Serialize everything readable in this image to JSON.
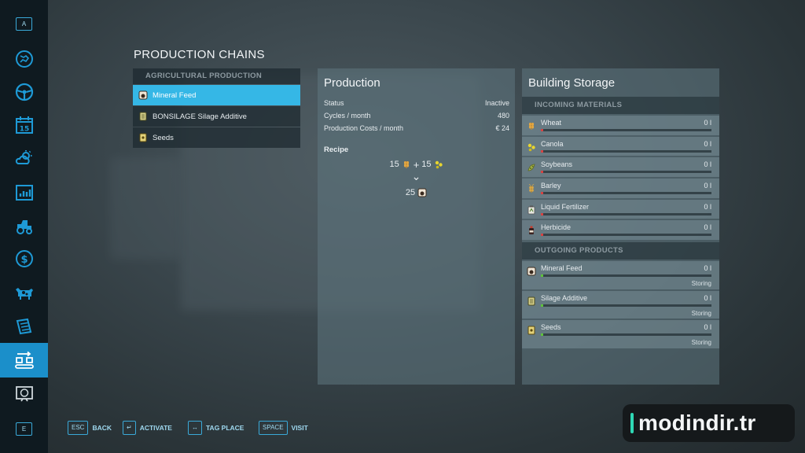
{
  "sidebar": {
    "top_key": "A",
    "bottom_key": "E",
    "items": [
      {
        "icon": "map-icon"
      },
      {
        "icon": "steering-wheel-icon"
      },
      {
        "icon": "calendar-icon",
        "label": "15"
      },
      {
        "icon": "weather-icon"
      },
      {
        "icon": "statistics-icon"
      },
      {
        "icon": "tractor-icon"
      },
      {
        "icon": "finances-icon"
      },
      {
        "icon": "animals-icon"
      },
      {
        "icon": "contracts-icon"
      },
      {
        "icon": "production-icon",
        "active": true
      },
      {
        "icon": "help-icon"
      }
    ]
  },
  "page_title": "PRODUCTION CHAINS",
  "chains": {
    "header": "AGRICULTURAL PRODUCTION",
    "items": [
      {
        "label": "Mineral Feed",
        "icon": "mineral-feed-icon",
        "selected": true
      },
      {
        "label": "BONSILAGE Silage Additive",
        "icon": "silage-additive-icon"
      },
      {
        "label": "Seeds",
        "icon": "seeds-icon"
      }
    ]
  },
  "production": {
    "title": "Production",
    "status_label": "Status",
    "status_value": "Inactive",
    "cycles_label": "Cycles / month",
    "cycles_value": "480",
    "costs_label": "Production Costs / month",
    "costs_value": "€ 24",
    "recipe_label": "Recipe",
    "recipe_inputs": [
      {
        "amount": "15",
        "icon": "wheat-icon"
      },
      {
        "amount": "15",
        "icon": "canola-icon"
      }
    ],
    "recipe_plus": "+",
    "recipe_arrow": "⌄",
    "recipe_output": {
      "amount": "25",
      "icon": "mineral-feed-icon"
    }
  },
  "storage": {
    "title": "Building Storage",
    "incoming_header": "INCOMING MATERIALS",
    "incoming": [
      {
        "name": "Wheat",
        "value": "0 l",
        "icon": "wheat-icon",
        "fill": 0
      },
      {
        "name": "Canola",
        "value": "0 l",
        "icon": "canola-icon",
        "fill": 0
      },
      {
        "name": "Soybeans",
        "value": "0 l",
        "icon": "soybeans-icon",
        "fill": 0
      },
      {
        "name": "Barley",
        "value": "0 l",
        "icon": "barley-icon",
        "fill": 0
      },
      {
        "name": "Liquid Fertilizer",
        "value": "0 l",
        "icon": "liquid-fertilizer-icon",
        "fill": 0
      },
      {
        "name": "Herbicide",
        "value": "0 l",
        "icon": "herbicide-icon",
        "fill": 0
      }
    ],
    "outgoing_header": "OUTGOING PRODUCTS",
    "outgoing": [
      {
        "name": "Mineral Feed",
        "value": "0 l",
        "status": "Storing",
        "icon": "mineral-feed-icon",
        "fill": 0
      },
      {
        "name": "Silage Additive",
        "value": "0 l",
        "status": "Storing",
        "icon": "silage-additive-icon",
        "fill": 0
      },
      {
        "name": "Seeds",
        "value": "0 l",
        "status": "Storing",
        "icon": "seeds-icon",
        "fill": 0
      }
    ],
    "colors": {
      "incoming_bar": "#d64242",
      "outgoing_bar": "#5ec43a"
    }
  },
  "footer": [
    {
      "key": "ESC",
      "label": "BACK"
    },
    {
      "key": "↵",
      "label": "ACTIVATE"
    },
    {
      "key": "↔",
      "label": "TAG PLACE"
    },
    {
      "key": "SPACE",
      "label": "VISIT"
    }
  ],
  "watermark": "modindir.tr",
  "colors": {
    "accent": "#1b8fca",
    "selected_item": "#35b7e6",
    "watermark_bar": "#2fd8b5"
  }
}
